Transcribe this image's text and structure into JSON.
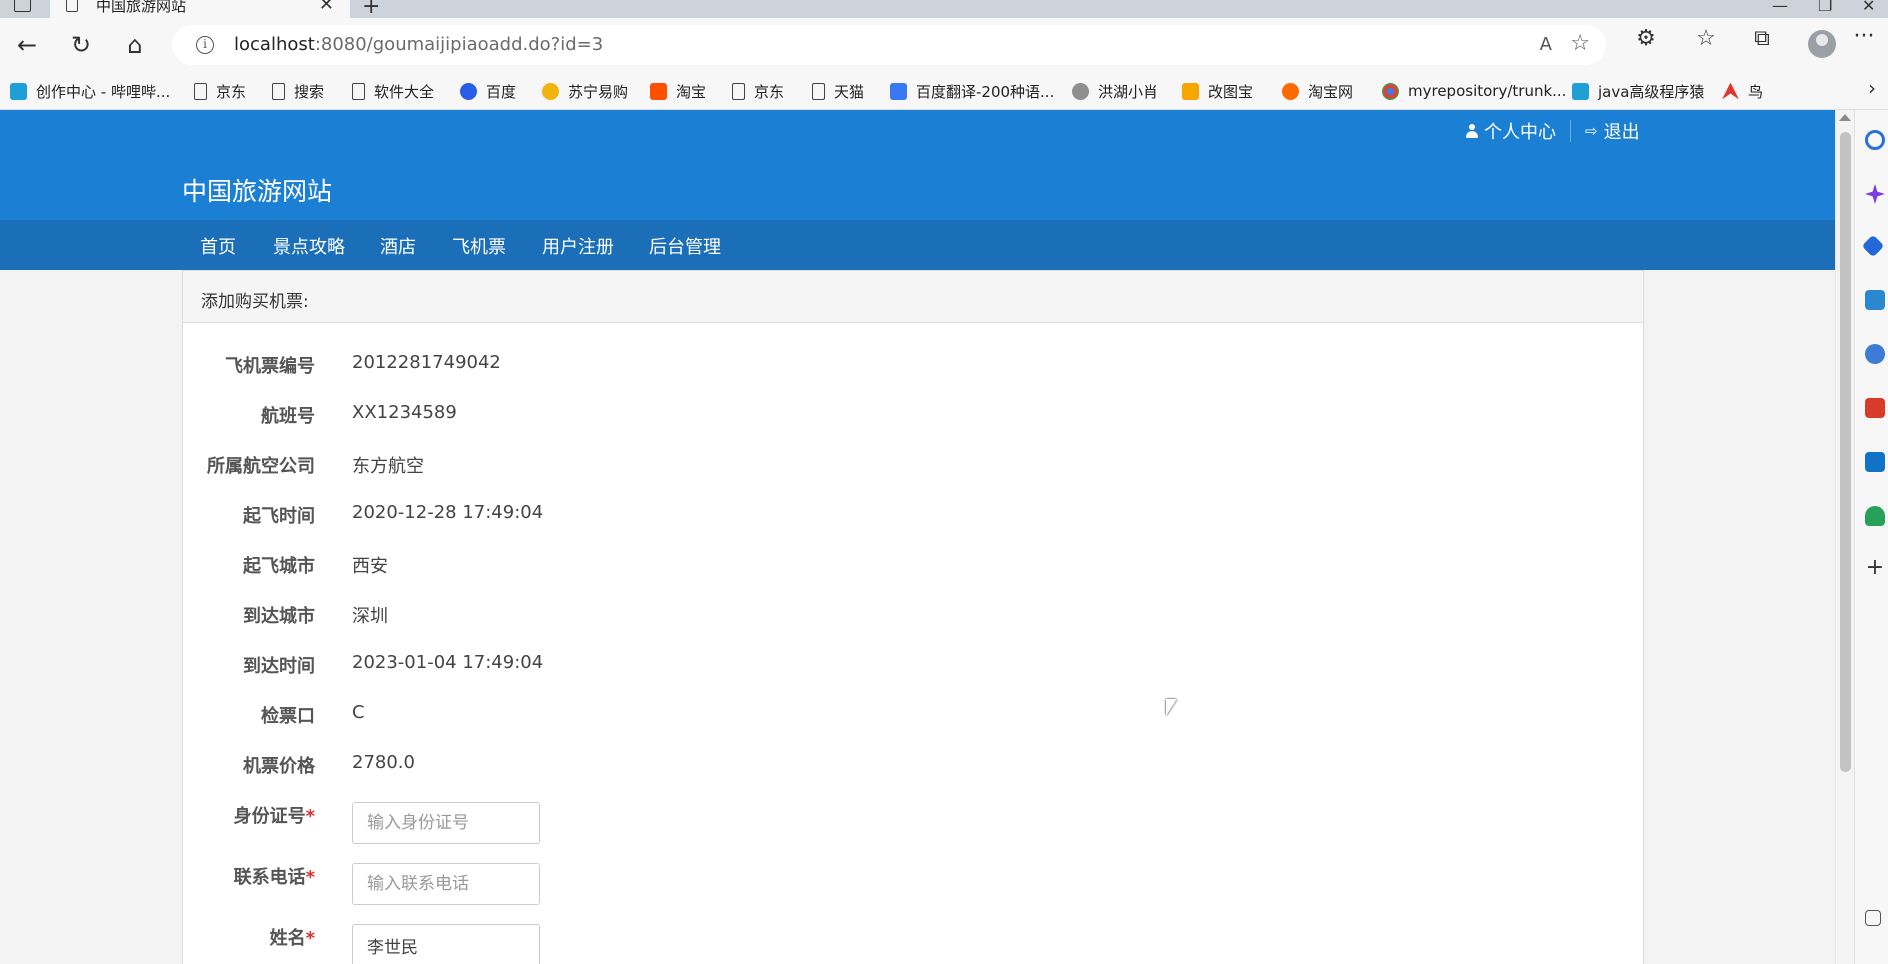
{
  "browser": {
    "tab_title": "中国旅游网站",
    "tab_close": "✕",
    "new_tab": "+",
    "window_controls": {
      "minimize": "—",
      "maximize": "❐",
      "close": "✕"
    },
    "url_host": "localhost",
    "url_rest": ":8080/goumaijipiaoadd.do?id=3",
    "icons": {
      "back": "back-arrow-icon",
      "refresh": "refresh-icon",
      "home": "home-icon",
      "info": "info-icon",
      "read_aloud": "read-aloud-icon",
      "add_favorite": "add-favorite-icon",
      "extensions": "extensions-icon",
      "favorites": "favorites-icon",
      "collections": "collections-icon",
      "profile": "profile-avatar",
      "more": "more-icon"
    },
    "glyphs": {
      "back": "←",
      "refresh": "↻",
      "home": "⌂",
      "info": "i",
      "read_aloud": "A",
      "add_favorite": "☆",
      "extensions": "⚙",
      "favorites": "☆",
      "collections": "⧉",
      "more": "···",
      "bookmarks_more": "›"
    }
  },
  "bookmarks": [
    {
      "label": "创作中心 - 哔哩哔...",
      "icon": "bili"
    },
    {
      "label": "京东",
      "icon": "page"
    },
    {
      "label": "搜索",
      "icon": "page"
    },
    {
      "label": "软件大全",
      "icon": "page"
    },
    {
      "label": "百度",
      "icon": "baidu"
    },
    {
      "label": "苏宁易购",
      "icon": "suning"
    },
    {
      "label": "淘宝",
      "icon": "tb"
    },
    {
      "label": "京东",
      "icon": "page"
    },
    {
      "label": "天猫",
      "icon": "page"
    },
    {
      "label": "百度翻译-200种语...",
      "icon": "fy"
    },
    {
      "label": "洪湖小肖",
      "icon": "hh"
    },
    {
      "label": "改图宝",
      "icon": "gtb"
    },
    {
      "label": "淘宝网",
      "icon": "tbw"
    },
    {
      "label": "myrepository/trunk...",
      "icon": "chrome"
    },
    {
      "label": "java高级程序猿",
      "icon": "bili"
    },
    {
      "label": "鸟",
      "icon": "bird"
    }
  ],
  "site": {
    "title": "中国旅游网站",
    "user_center": "个人中心",
    "logout": "退出",
    "logout_glyph": "⇨",
    "nav": [
      "首页",
      "景点攻略",
      "酒店",
      "飞机票",
      "用户注册",
      "后台管理"
    ]
  },
  "form": {
    "panel_title": "添加购买机票:",
    "rows": [
      {
        "label": "飞机票编号",
        "value": "2012281749042"
      },
      {
        "label": "航班号",
        "value": "XX1234589"
      },
      {
        "label": "所属航空公司",
        "value": "东方航空"
      },
      {
        "label": "起飞时间",
        "value": "2020-12-28 17:49:04"
      },
      {
        "label": "起飞城市",
        "value": "西安"
      },
      {
        "label": "到达城市",
        "value": "深圳"
      },
      {
        "label": "到达时间",
        "value": "2023-01-04 17:49:04"
      },
      {
        "label": "检票口",
        "value": "C"
      },
      {
        "label": "机票价格",
        "value": "2780.0"
      }
    ],
    "inputs": [
      {
        "label": "身份证号",
        "required_mark": "*",
        "placeholder": "输入身份证号",
        "value": ""
      },
      {
        "label": "联系电话",
        "required_mark": "*",
        "placeholder": "输入联系电话",
        "value": ""
      },
      {
        "label": "姓名",
        "required_mark": "*",
        "placeholder": "",
        "value": "李世民"
      }
    ]
  },
  "colors": {
    "header_blue": "#1b7fd3",
    "nav_blue": "#1a6fb8",
    "required_red": "#d9302c"
  }
}
